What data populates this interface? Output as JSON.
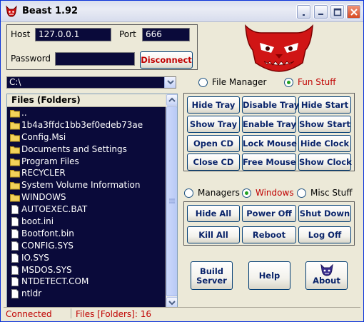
{
  "window": {
    "title": "Beast 1.92"
  },
  "connection": {
    "host_label": "Host",
    "host_value": "127.0.0.1",
    "port_label": "Port",
    "port_value": "666",
    "password_label": "Password",
    "password_value": "",
    "disconnect_label": "Disconnect"
  },
  "path": {
    "value": "C:\\"
  },
  "files": {
    "header": "Files (Folders)",
    "items": [
      {
        "name": "..",
        "type": "folder"
      },
      {
        "name": "1b4a3ffdc1bb3ef0edeb73ae",
        "type": "folder"
      },
      {
        "name": "Config.Msi",
        "type": "folder"
      },
      {
        "name": "Documents and Settings",
        "type": "folder"
      },
      {
        "name": "Program Files",
        "type": "folder"
      },
      {
        "name": "RECYCLER",
        "type": "folder"
      },
      {
        "name": "System Volume Information",
        "type": "folder"
      },
      {
        "name": "WINDOWS",
        "type": "folder"
      },
      {
        "name": "AUTOEXEC.BAT",
        "type": "file"
      },
      {
        "name": "boot.ini",
        "type": "file"
      },
      {
        "name": "Bootfont.bin",
        "type": "file"
      },
      {
        "name": "CONFIG.SYS",
        "type": "file"
      },
      {
        "name": "IO.SYS",
        "type": "file"
      },
      {
        "name": "MSDOS.SYS",
        "type": "file"
      },
      {
        "name": "NTDETECT.COM",
        "type": "file"
      },
      {
        "name": "ntldr",
        "type": "file"
      }
    ]
  },
  "mode_radio": {
    "file_manager": "File Manager",
    "fun_stuff": "Fun Stuff",
    "selected": "fun_stuff"
  },
  "fun_buttons": {
    "hide_tray": "Hide Tray",
    "disable_tray": "Disable Tray",
    "hide_start": "Hide Start",
    "show_tray": "Show Tray",
    "enable_tray": "Enable Tray",
    "show_start": "Show Start",
    "open_cd": "Open CD",
    "lock_mouse": "Lock Mouse",
    "hide_clock": "Hide Clock",
    "close_cd": "Close CD",
    "free_mouse": "Free Mouse",
    "show_clock": "Show Clock"
  },
  "sub_radio": {
    "managers": "Managers",
    "windows": "Windows",
    "misc_stuff": "Misc Stuff",
    "selected": "windows"
  },
  "windows_buttons": {
    "hide_all": "Hide All",
    "power_off": "Power Off",
    "shut_down": "Shut Down",
    "kill_all": "Kill All",
    "reboot": "Reboot",
    "log_off": "Log Off"
  },
  "bottom_buttons": {
    "build_server_l1": "Build",
    "build_server_l2": "Server",
    "help": "Help",
    "about": "About"
  },
  "status": {
    "connection": "Connected",
    "files_count": "Files [Folders]: 16"
  },
  "colors": {
    "accent_red": "#c00000",
    "dark_field": "#0a0a3a",
    "button_text": "#0a246a"
  }
}
